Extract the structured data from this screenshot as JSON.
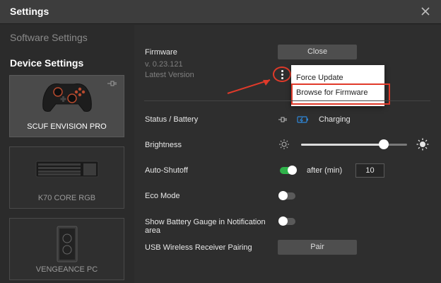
{
  "window": {
    "title": "Settings"
  },
  "sidebar": {
    "software_heading": "Software Settings",
    "device_heading": "Device Settings",
    "devices": [
      {
        "label": "SCUF ENVISION PRO",
        "icon": "controller-icon",
        "active": true
      },
      {
        "label": "K70 CORE RGB",
        "icon": "keyboard-icon",
        "active": false
      },
      {
        "label": "VENGEANCE PC",
        "icon": "pc-tower-icon",
        "active": false
      }
    ]
  },
  "firmware": {
    "label": "Firmware",
    "version": "v. 0.23.121",
    "status": "Latest Version",
    "close_button": "Close"
  },
  "menu": {
    "items": [
      "Force Update",
      "Browse for Firmware"
    ],
    "highlighted": "Browse for Firmware"
  },
  "settings": {
    "status_label": "Status / Battery",
    "status_value": "Charging",
    "brightness_label": "Brightness",
    "brightness_level": 0.78,
    "autoshutoff_label": "Auto-Shutoff",
    "autoshutoff_on": true,
    "after_label": "after (min)",
    "after_value": "10",
    "eco_label": "Eco Mode",
    "eco_on": false,
    "battery_gauge_label_1": "Show Battery Gauge in Notification",
    "battery_gauge_label_2": "area",
    "battery_gauge_on": false,
    "pairing_label": "USB Wireless Receiver Pairing",
    "pair_button": "Pair"
  },
  "colors": {
    "accent_green": "#2fb24a",
    "charging_blue": "#2f86d6",
    "annotation_red": "#e03a2a"
  }
}
